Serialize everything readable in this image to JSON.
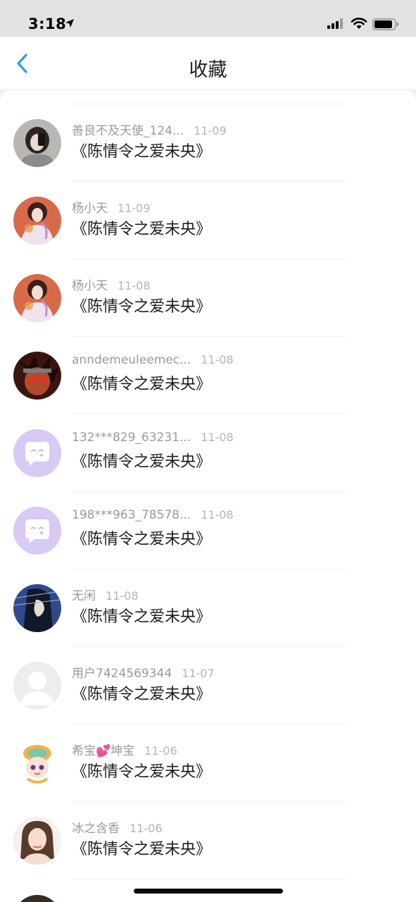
{
  "status_bar": {
    "time": "3:18"
  },
  "nav": {
    "title": "收藏"
  },
  "colors": {
    "accent": "#2a9be9",
    "meta_text": "#9a9a9a",
    "title_text": "#1c1c1c",
    "default_avatar": "#d9c9f5"
  },
  "items": [
    {
      "user": "善良不及天使_124...",
      "date": "11-09",
      "title": "《陈情令之爱未央》",
      "avatar": "photo-dark"
    },
    {
      "user": "杨小天",
      "date": "11-09",
      "title": "《陈情令之爱未央》",
      "avatar": "photo-costume"
    },
    {
      "user": "杨小天",
      "date": "11-08",
      "title": "《陈情令之爱未央》",
      "avatar": "photo-costume"
    },
    {
      "user": "anndemeuleemec...",
      "date": "11-08",
      "title": "《陈情令之爱未央》",
      "avatar": "photo-anime-red"
    },
    {
      "user": "132***829_63231...",
      "date": "11-08",
      "title": "《陈情令之爱未央》",
      "avatar": "default-purple"
    },
    {
      "user": "198***963_78578...",
      "date": "11-08",
      "title": "《陈情令之爱未央》",
      "avatar": "default-purple"
    },
    {
      "user": "无闲",
      "date": "11-08",
      "title": "《陈情令之爱未央》",
      "avatar": "photo-anime-blue"
    },
    {
      "user": "用户7424569344",
      "date": "11-07",
      "title": "《陈情令之爱未央》",
      "avatar": "default-gray"
    },
    {
      "user": "希宝💕坤宝",
      "date": "11-06",
      "title": "《陈情令之爱未央》",
      "avatar": "sticker-cartoon"
    },
    {
      "user": "冰之含香",
      "date": "11-06",
      "title": "《陈情令之爱未央》",
      "avatar": "photo-woman"
    }
  ]
}
